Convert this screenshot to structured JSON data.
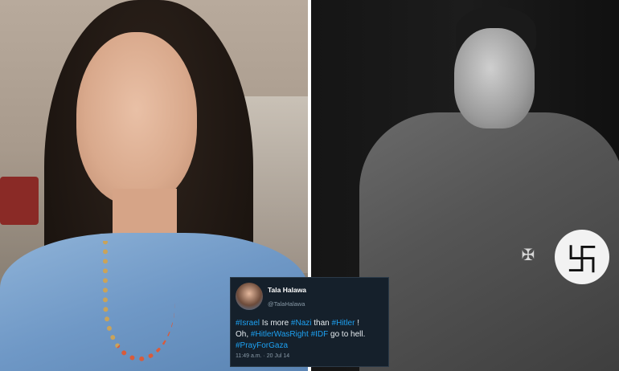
{
  "photos": {
    "left": {
      "kind": "color-portrait-photo"
    },
    "right": {
      "kind": "black-and-white-portrait-photo"
    }
  },
  "tweet": {
    "display_name": "Tala Halawa",
    "handle": "@TalaHalawa",
    "line1": {
      "t1": "#Israel",
      "t2": " Is more ",
      "t3": "#Nazi",
      "t4": " than ",
      "t5": "#Hitler",
      "t6": " !"
    },
    "line2": {
      "t1": "Oh, ",
      "t2": "#HitlerWasRight",
      "t3": " ",
      "t4": "#IDF",
      "t5": " go to hell."
    },
    "line3": {
      "t1": "#PrayForGaza"
    },
    "timestamp": "11:49 a.m. · 20 Jul 14",
    "colors": {
      "background": "#15202b",
      "hashtag": "#1da1f2",
      "text": "#e6ecf0",
      "muted": "#8899a6"
    }
  }
}
